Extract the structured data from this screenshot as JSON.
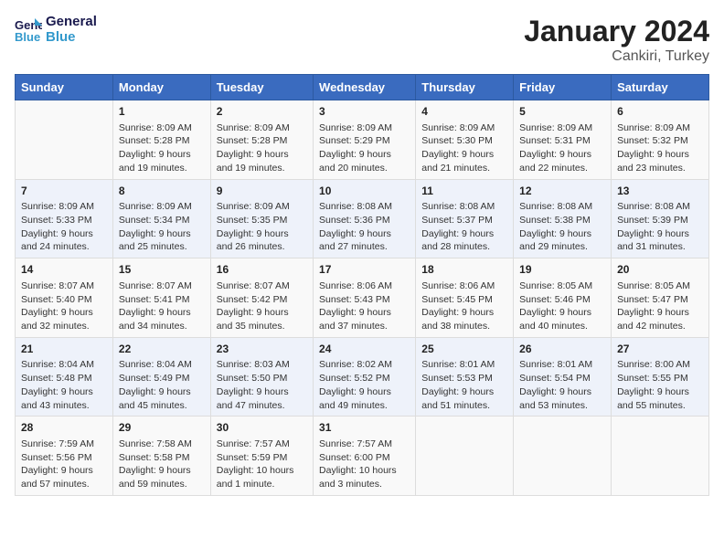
{
  "logo": {
    "text_general": "General",
    "text_blue": "Blue"
  },
  "title": "January 2024",
  "subtitle": "Cankiri, Turkey",
  "days_of_week": [
    "Sunday",
    "Monday",
    "Tuesday",
    "Wednesday",
    "Thursday",
    "Friday",
    "Saturday"
  ],
  "weeks": [
    [
      {
        "day": "",
        "content": ""
      },
      {
        "day": "1",
        "content": "Sunrise: 8:09 AM\nSunset: 5:28 PM\nDaylight: 9 hours\nand 19 minutes."
      },
      {
        "day": "2",
        "content": "Sunrise: 8:09 AM\nSunset: 5:28 PM\nDaylight: 9 hours\nand 19 minutes."
      },
      {
        "day": "3",
        "content": "Sunrise: 8:09 AM\nSunset: 5:29 PM\nDaylight: 9 hours\nand 20 minutes."
      },
      {
        "day": "4",
        "content": "Sunrise: 8:09 AM\nSunset: 5:30 PM\nDaylight: 9 hours\nand 21 minutes."
      },
      {
        "day": "5",
        "content": "Sunrise: 8:09 AM\nSunset: 5:31 PM\nDaylight: 9 hours\nand 22 minutes."
      },
      {
        "day": "6",
        "content": "Sunrise: 8:09 AM\nSunset: 5:32 PM\nDaylight: 9 hours\nand 23 minutes."
      }
    ],
    [
      {
        "day": "7",
        "content": "Sunrise: 8:09 AM\nSunset: 5:33 PM\nDaylight: 9 hours\nand 24 minutes."
      },
      {
        "day": "8",
        "content": "Sunrise: 8:09 AM\nSunset: 5:34 PM\nDaylight: 9 hours\nand 25 minutes."
      },
      {
        "day": "9",
        "content": "Sunrise: 8:09 AM\nSunset: 5:35 PM\nDaylight: 9 hours\nand 26 minutes."
      },
      {
        "day": "10",
        "content": "Sunrise: 8:08 AM\nSunset: 5:36 PM\nDaylight: 9 hours\nand 27 minutes."
      },
      {
        "day": "11",
        "content": "Sunrise: 8:08 AM\nSunset: 5:37 PM\nDaylight: 9 hours\nand 28 minutes."
      },
      {
        "day": "12",
        "content": "Sunrise: 8:08 AM\nSunset: 5:38 PM\nDaylight: 9 hours\nand 29 minutes."
      },
      {
        "day": "13",
        "content": "Sunrise: 8:08 AM\nSunset: 5:39 PM\nDaylight: 9 hours\nand 31 minutes."
      }
    ],
    [
      {
        "day": "14",
        "content": "Sunrise: 8:07 AM\nSunset: 5:40 PM\nDaylight: 9 hours\nand 32 minutes."
      },
      {
        "day": "15",
        "content": "Sunrise: 8:07 AM\nSunset: 5:41 PM\nDaylight: 9 hours\nand 34 minutes."
      },
      {
        "day": "16",
        "content": "Sunrise: 8:07 AM\nSunset: 5:42 PM\nDaylight: 9 hours\nand 35 minutes."
      },
      {
        "day": "17",
        "content": "Sunrise: 8:06 AM\nSunset: 5:43 PM\nDaylight: 9 hours\nand 37 minutes."
      },
      {
        "day": "18",
        "content": "Sunrise: 8:06 AM\nSunset: 5:45 PM\nDaylight: 9 hours\nand 38 minutes."
      },
      {
        "day": "19",
        "content": "Sunrise: 8:05 AM\nSunset: 5:46 PM\nDaylight: 9 hours\nand 40 minutes."
      },
      {
        "day": "20",
        "content": "Sunrise: 8:05 AM\nSunset: 5:47 PM\nDaylight: 9 hours\nand 42 minutes."
      }
    ],
    [
      {
        "day": "21",
        "content": "Sunrise: 8:04 AM\nSunset: 5:48 PM\nDaylight: 9 hours\nand 43 minutes."
      },
      {
        "day": "22",
        "content": "Sunrise: 8:04 AM\nSunset: 5:49 PM\nDaylight: 9 hours\nand 45 minutes."
      },
      {
        "day": "23",
        "content": "Sunrise: 8:03 AM\nSunset: 5:50 PM\nDaylight: 9 hours\nand 47 minutes."
      },
      {
        "day": "24",
        "content": "Sunrise: 8:02 AM\nSunset: 5:52 PM\nDaylight: 9 hours\nand 49 minutes."
      },
      {
        "day": "25",
        "content": "Sunrise: 8:01 AM\nSunset: 5:53 PM\nDaylight: 9 hours\nand 51 minutes."
      },
      {
        "day": "26",
        "content": "Sunrise: 8:01 AM\nSunset: 5:54 PM\nDaylight: 9 hours\nand 53 minutes."
      },
      {
        "day": "27",
        "content": "Sunrise: 8:00 AM\nSunset: 5:55 PM\nDaylight: 9 hours\nand 55 minutes."
      }
    ],
    [
      {
        "day": "28",
        "content": "Sunrise: 7:59 AM\nSunset: 5:56 PM\nDaylight: 9 hours\nand 57 minutes."
      },
      {
        "day": "29",
        "content": "Sunrise: 7:58 AM\nSunset: 5:58 PM\nDaylight: 9 hours\nand 59 minutes."
      },
      {
        "day": "30",
        "content": "Sunrise: 7:57 AM\nSunset: 5:59 PM\nDaylight: 10 hours\nand 1 minute."
      },
      {
        "day": "31",
        "content": "Sunrise: 7:57 AM\nSunset: 6:00 PM\nDaylight: 10 hours\nand 3 minutes."
      },
      {
        "day": "",
        "content": ""
      },
      {
        "day": "",
        "content": ""
      },
      {
        "day": "",
        "content": ""
      }
    ]
  ]
}
